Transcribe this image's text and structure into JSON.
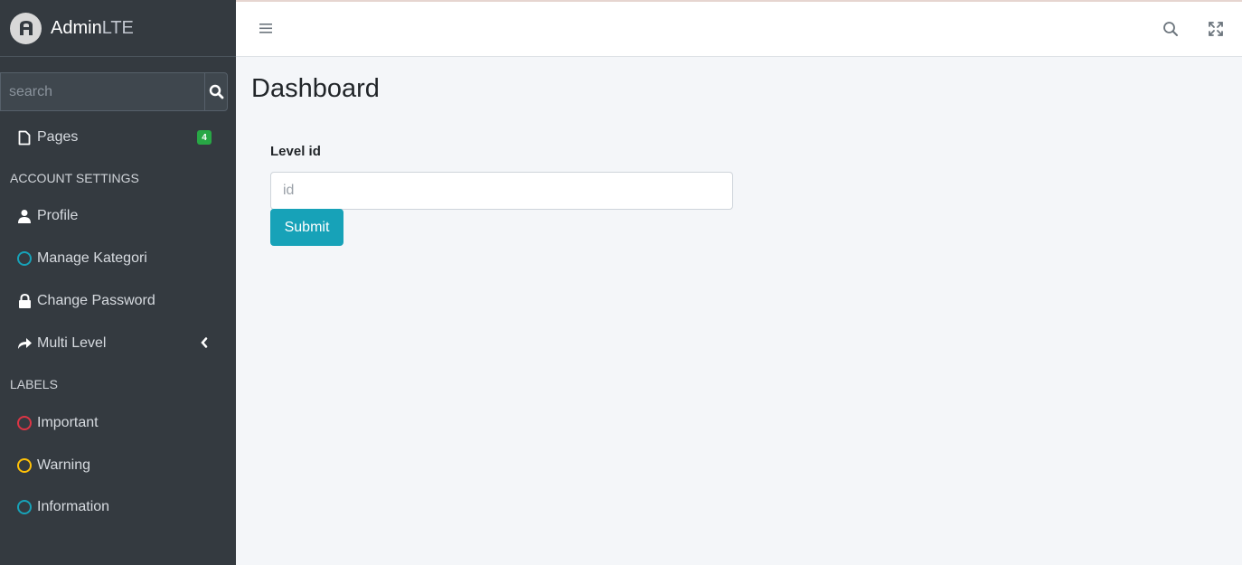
{
  "brand": {
    "name_bold": "Admin",
    "name_light": "LTE"
  },
  "sidebar": {
    "search_placeholder": "search",
    "pages": {
      "label": "Pages",
      "badge": "4"
    },
    "account_header": "ACCOUNT SETTINGS",
    "items": [
      {
        "label": "Profile",
        "icon": "user-icon"
      },
      {
        "label": "Manage Kategori",
        "icon": "circle-icon",
        "color": "#17a2b8"
      },
      {
        "label": "Change Password",
        "icon": "lock-icon"
      },
      {
        "label": "Multi Level",
        "icon": "share-icon"
      }
    ],
    "labels_header": "LABELS",
    "labels": [
      {
        "label": "Important",
        "color": "#dc3545"
      },
      {
        "label": "Warning",
        "color": "#ffc107"
      },
      {
        "label": "Information",
        "color": "#17a2b8"
      }
    ]
  },
  "content": {
    "title": "Dashboard",
    "form_label": "Level id",
    "input_placeholder": "id",
    "submit_label": "Submit"
  },
  "colors": {
    "sidebar_bg": "#343a40",
    "accent": "#17a2b8",
    "badge": "#28a745"
  }
}
